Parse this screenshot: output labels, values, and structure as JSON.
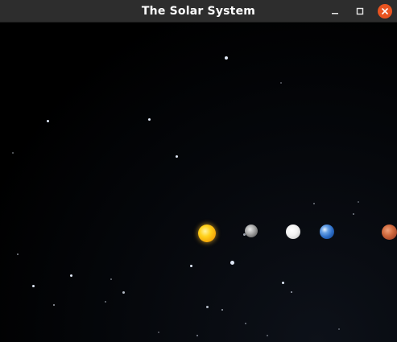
{
  "window": {
    "title": "The Solar System",
    "controls": {
      "minimize_icon": "minimize-icon",
      "maximize_icon": "maximize-icon",
      "close_icon": "close-icon"
    }
  },
  "scene": {
    "background_color": "#000000",
    "bodies": [
      {
        "name": "sun",
        "color": "#ffc21a"
      },
      {
        "name": "mercury",
        "color": "#9a9a9a"
      },
      {
        "name": "venus",
        "color": "#f2f2f2"
      },
      {
        "name": "earth",
        "color": "#2e6fc8"
      },
      {
        "name": "mars",
        "color": "#c0502a"
      }
    ]
  }
}
